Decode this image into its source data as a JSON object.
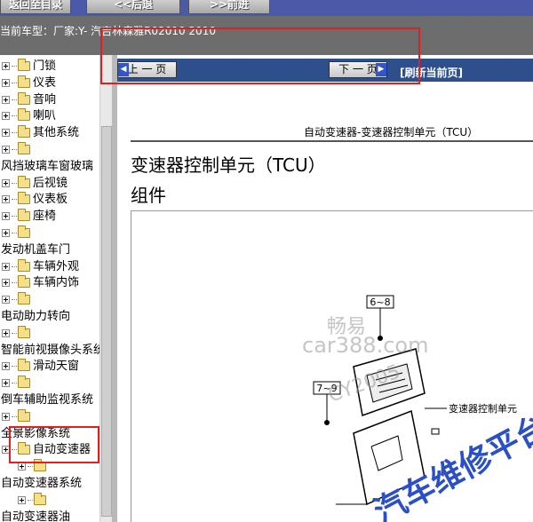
{
  "toolbar": {
    "buttons": [
      "返回至目录",
      "<<后退",
      ">>前进"
    ]
  },
  "model_bar": {
    "label": "当前车型：厂家:Y- 汽吉林森雅R02010 2010"
  },
  "tree": {
    "items": [
      {
        "label": "门锁",
        "indent": 1
      },
      {
        "label": "仪表",
        "indent": 1
      },
      {
        "label": "音响",
        "indent": 1
      },
      {
        "label": "喇叭",
        "indent": 1
      },
      {
        "label": "其他系统",
        "indent": 1
      },
      {
        "label": "",
        "indent": 1
      },
      {
        "label": "风挡玻璃车窗玻璃",
        "indent": 0
      },
      {
        "label": "后视镜",
        "indent": 1
      },
      {
        "label": "仪表板",
        "indent": 1
      },
      {
        "label": "座椅",
        "indent": 1
      },
      {
        "label": "",
        "indent": 1
      },
      {
        "label": "发动机盖车门",
        "indent": 0
      },
      {
        "label": "车辆外观",
        "indent": 1
      },
      {
        "label": "车辆内饰",
        "indent": 1
      },
      {
        "label": "",
        "indent": 1
      },
      {
        "label": "电动助力转向",
        "indent": 0
      },
      {
        "label": "",
        "indent": 1
      },
      {
        "label": "智能前视摄像头系统",
        "indent": 0
      },
      {
        "label": "滑动天窗",
        "indent": 1
      },
      {
        "label": "",
        "indent": 1
      },
      {
        "label": "倒车辅助监视系统",
        "indent": 0
      },
      {
        "label": "",
        "indent": 1
      },
      {
        "label": "全景影像系统",
        "indent": 0
      },
      {
        "label": "自动变速器",
        "indent": 1
      },
      {
        "label": "",
        "indent": 2
      },
      {
        "label": "自动变速器系统",
        "indent": 0
      },
      {
        "label": "",
        "indent": 2
      },
      {
        "label": "自动变速器油",
        "indent": 0
      },
      {
        "label": "",
        "indent": 2
      }
    ]
  },
  "nav": {
    "prev_label": "上 一 页",
    "next_label": "下 一 页",
    "refresh_label": "[刷新当前页]"
  },
  "doc": {
    "header": "自动变速器-变速器控制单元（TCU）",
    "title": "变速器控制单元（TCU）",
    "subtitle": "组件"
  },
  "figure": {
    "labels": [
      "6~8",
      "7~9",
      "变速器控制单元"
    ]
  },
  "watermark": {
    "lines": [
      "畅易",
      "car388.com",
      "CY2005",
      "汽车维修平台"
    ]
  },
  "colors": {
    "toolbar_bg": "#4a5aa8",
    "model_bar_bg": "#6d6d6d",
    "nav_bar_bg": "#2d4f8c",
    "annotation": "#e02020"
  }
}
